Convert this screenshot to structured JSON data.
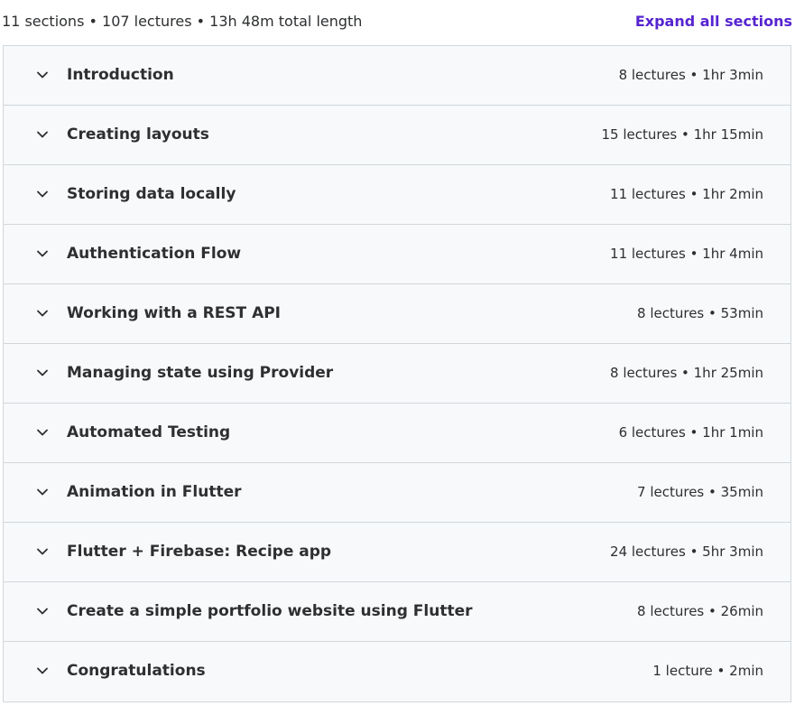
{
  "header": {
    "summary": "11 sections • 107 lectures • 13h 48m total length",
    "expand_label": "Expand all sections"
  },
  "sections": [
    {
      "title": "Introduction",
      "meta": "8 lectures • 1hr 3min"
    },
    {
      "title": "Creating layouts",
      "meta": "15 lectures • 1hr 15min"
    },
    {
      "title": "Storing data locally",
      "meta": "11 lectures • 1hr 2min"
    },
    {
      "title": "Authentication Flow",
      "meta": "11 lectures • 1hr 4min"
    },
    {
      "title": "Working with a REST API",
      "meta": "8 lectures • 53min"
    },
    {
      "title": "Managing state using Provider",
      "meta": "8 lectures • 1hr 25min"
    },
    {
      "title": "Automated Testing",
      "meta": "6 lectures • 1hr 1min"
    },
    {
      "title": "Animation in Flutter",
      "meta": "7 lectures • 35min"
    },
    {
      "title": "Flutter + Firebase: Recipe app",
      "meta": "24 lectures • 5hr 3min"
    },
    {
      "title": "Create a simple portfolio website using Flutter",
      "meta": "8 lectures • 26min"
    },
    {
      "title": "Congratulations",
      "meta": "1 lecture • 2min"
    }
  ],
  "icons": {
    "section_toggle": "chevron-down-icon"
  },
  "colors": {
    "accent": "#5624d0",
    "row_background": "#f7f9fa",
    "border": "#d1d7dc",
    "text": "#2d2f31"
  }
}
